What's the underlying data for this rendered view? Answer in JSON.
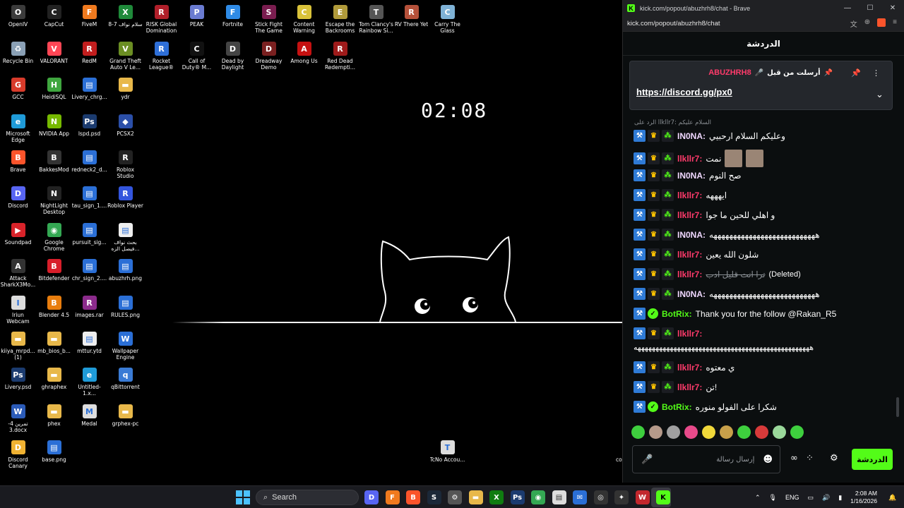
{
  "desktop": {
    "clock": "02:08",
    "icons": [
      {
        "label": "OpenIV",
        "color": "#3b3b3b",
        "glyph": "O"
      },
      {
        "label": "CapCut",
        "color": "#222222",
        "glyph": "C"
      },
      {
        "label": "FiveM",
        "color": "#f07a1e",
        "glyph": "F"
      },
      {
        "label": "سلام نواف 7-8",
        "color": "#1f8a3a",
        "glyph": "X"
      },
      {
        "label": "RISK Global Domination",
        "color": "#b01f2a",
        "glyph": "R"
      },
      {
        "label": "PEAK",
        "color": "#6a7bd1",
        "glyph": "P"
      },
      {
        "label": "Fortnite",
        "color": "#2f8be6",
        "glyph": "F"
      },
      {
        "label": "Stick Fight The Game",
        "color": "#7a1d4f",
        "glyph": "S"
      },
      {
        "label": "Content Warning",
        "color": "#d9c23a",
        "glyph": "C"
      },
      {
        "label": "Escape the Backrooms",
        "color": "#b09a3a",
        "glyph": "E"
      },
      {
        "label": "Tom Clancy's Rainbow Si...",
        "color": "#555555",
        "glyph": "T"
      },
      {
        "label": "RV There Yet",
        "color": "#b5513a",
        "glyph": "R"
      },
      {
        "label": "Carry The Glass",
        "color": "#7fb2d6",
        "glyph": "C"
      },
      {
        "label": "Recycle Bin",
        "color": "#8aa0b5",
        "glyph": "♻"
      },
      {
        "label": "VALORANT",
        "color": "#ff4655",
        "glyph": "V"
      },
      {
        "label": "RedM",
        "color": "#c21e1e",
        "glyph": "R"
      },
      {
        "label": "Grand Theft Auto V Le...",
        "color": "#6b8e23",
        "glyph": "V"
      },
      {
        "label": "Rocket League®",
        "color": "#2e6fd8",
        "glyph": "R"
      },
      {
        "label": "Call of Duty® M...",
        "color": "#111111",
        "glyph": "C"
      },
      {
        "label": "Dead by Daylight",
        "color": "#444444",
        "glyph": "D"
      },
      {
        "label": "Dreadway Demo",
        "color": "#7a2020",
        "glyph": "D"
      },
      {
        "label": "Among Us",
        "color": "#c51111",
        "glyph": "A"
      },
      {
        "label": "Red Dead Redempti...",
        "color": "#9e1b1b",
        "glyph": "R"
      },
      {
        "label": "GCC",
        "color": "#d83b2b",
        "glyph": "G"
      },
      {
        "label": "HeidiSQL",
        "color": "#3fa63f",
        "glyph": "H"
      },
      {
        "label": "Livery_chrg...",
        "color": "#2b6fd6",
        "glyph": "▤"
      },
      {
        "label": "ydr",
        "color": "#e8b84a",
        "glyph": "▬"
      },
      {
        "label": "Microsoft Edge",
        "color": "#1f9bd8",
        "glyph": "e"
      },
      {
        "label": "NVIDIA App",
        "color": "#76b900",
        "glyph": "N"
      },
      {
        "label": "lspd.psd",
        "color": "#1b3b6f",
        "glyph": "Ps"
      },
      {
        "label": "PCSX2",
        "color": "#2b4fa8",
        "glyph": "◆"
      },
      {
        "label": "Brave",
        "color": "#fb542b",
        "glyph": "B"
      },
      {
        "label": "BakkesMod",
        "color": "#333333",
        "glyph": "B"
      },
      {
        "label": "redneck2_d...",
        "color": "#2b6fd6",
        "glyph": "▤"
      },
      {
        "label": "Roblox Studio",
        "color": "#222222",
        "glyph": "R"
      },
      {
        "label": "Discord",
        "color": "#5865f2",
        "glyph": "D"
      },
      {
        "label": "NightLight Desktop",
        "color": "#222222",
        "glyph": "N"
      },
      {
        "label": "tau_sign_1....",
        "color": "#2b6fd6",
        "glyph": "▤"
      },
      {
        "label": "Roblox Player",
        "color": "#3355dd",
        "glyph": "R"
      },
      {
        "label": "Soundpad",
        "color": "#d8232a",
        "glyph": "▶"
      },
      {
        "label": "Google Chrome",
        "color": "#34a853",
        "glyph": "◉"
      },
      {
        "label": "pursuit_sig...",
        "color": "#2b6fd6",
        "glyph": "▤"
      },
      {
        "label": "بحث نواف فيصل الزه...",
        "color": "#eeeeee",
        "glyph": "▤"
      },
      {
        "label": "Attack SharkX3Mo...",
        "color": "#333333",
        "glyph": "A"
      },
      {
        "label": "Bitdefender",
        "color": "#d81e2a",
        "glyph": "B"
      },
      {
        "label": "chr_sign_2....",
        "color": "#2b6fd6",
        "glyph": "▤"
      },
      {
        "label": "abuzhrh.png",
        "color": "#2b6fd6",
        "glyph": "▤"
      },
      {
        "label": "Iriun Webcam",
        "color": "#dddddd",
        "glyph": "I"
      },
      {
        "label": "Blender 4.5",
        "color": "#e87d0d",
        "glyph": "B"
      },
      {
        "label": "images.rar",
        "color": "#8b2b8b",
        "glyph": "R"
      },
      {
        "label": "RULES.png",
        "color": "#2b6fd6",
        "glyph": "▤"
      },
      {
        "label": "kiiya_mrpd... (1)",
        "color": "#e8b84a",
        "glyph": "▬"
      },
      {
        "label": "mb_bios_b...",
        "color": "#e8b84a",
        "glyph": "▬"
      },
      {
        "label": "mttur.ytd",
        "color": "#eeeeee",
        "glyph": "▤"
      },
      {
        "label": "Wallpaper Engine",
        "color": "#2b6fd6",
        "glyph": "W"
      },
      {
        "label": "Livery.psd",
        "color": "#1b3b6f",
        "glyph": "Ps"
      },
      {
        "label": "ghraphex",
        "color": "#e8b84a",
        "glyph": "▬"
      },
      {
        "label": "Untitled-1.x...",
        "color": "#1f9bd8",
        "glyph": "e"
      },
      {
        "label": "qBittorrent",
        "color": "#3a7bd5",
        "glyph": "q"
      },
      {
        "label": "تمرين 4-3.docx",
        "color": "#2b5bb8",
        "glyph": "W"
      },
      {
        "label": "phex",
        "color": "#e8b84a",
        "glyph": "▬"
      },
      {
        "label": "Medal",
        "color": "#dddddd",
        "glyph": "M"
      },
      {
        "label": "grphex-pc",
        "color": "#e8b84a",
        "glyph": "▬"
      },
      {
        "label": "Discord Canary",
        "color": "#f0b232",
        "glyph": "D"
      },
      {
        "label": "base.png",
        "color": "#2b6fd6",
        "glyph": "▤"
      },
      {
        "label": "TcNo Accou...",
        "color": "#dddddd",
        "glyph": "T"
      },
      {
        "label": "conte",
        "color": "#000000",
        "glyph": ""
      }
    ]
  },
  "taskbar": {
    "search_placeholder": "Search",
    "apps": [
      {
        "name": "discord",
        "color": "#5865f2",
        "glyph": "D"
      },
      {
        "name": "fivem",
        "color": "#f07a1e",
        "glyph": "F"
      },
      {
        "name": "brave",
        "color": "#fb542b",
        "glyph": "B"
      },
      {
        "name": "steam",
        "color": "#1b2838",
        "glyph": "S"
      },
      {
        "name": "settings",
        "color": "#555555",
        "glyph": "⚙"
      },
      {
        "name": "file-explorer",
        "color": "#e8b84a",
        "glyph": "▬"
      },
      {
        "name": "xbox",
        "color": "#107c10",
        "glyph": "X"
      },
      {
        "name": "photoshop",
        "color": "#1b3b6f",
        "glyph": "Ps"
      },
      {
        "name": "chrome",
        "color": "#34a853",
        "glyph": "◉"
      },
      {
        "name": "notepad",
        "color": "#dddddd",
        "glyph": "▤"
      },
      {
        "name": "mail",
        "color": "#2b6fd6",
        "glyph": "✉"
      },
      {
        "name": "obs",
        "color": "#333333",
        "glyph": "◎"
      },
      {
        "name": "tool",
        "color": "#333333",
        "glyph": "✦"
      },
      {
        "name": "writer",
        "color": "#c2272d",
        "glyph": "W"
      },
      {
        "name": "kick",
        "color": "#53fc18",
        "glyph": "K"
      }
    ],
    "tray": {
      "language": "ENG",
      "time": "2:08 AM",
      "date": "1/16/2026"
    }
  },
  "browser": {
    "title": "kick.com/popout/abuzhrh8/chat - Brave",
    "url": "kick.com/popout/abuzhrh8/chat",
    "chat_title": "الدردشة",
    "pinned": {
      "sent_by_label": "أرسلت من قبل",
      "user": "ABUZHRH8",
      "link": "https://discord.gg/px0"
    },
    "reply_to": "الرد على llkllr7: السلام عليكم",
    "messages": [
      {
        "user": "IN0NA",
        "user_color": "#f0d8ff",
        "text": "وعليكم السلام ارحبيي",
        "type": "sub"
      },
      {
        "user": "llkllr7",
        "user_color": "#ff3b6b",
        "text": "نمت",
        "type": "sub",
        "thumbs": 2
      },
      {
        "user": "IN0NA",
        "user_color": "#f0d8ff",
        "text": "صح النوم",
        "type": "sub"
      },
      {
        "user": "llkllr7",
        "user_color": "#ff3b6b",
        "text": "ايهههه",
        "type": "sub"
      },
      {
        "user": "llkllr7",
        "user_color": "#ff3b6b",
        "text": "و اهلي للحين ما جوا",
        "type": "sub"
      },
      {
        "user": "IN0NA",
        "user_color": "#f0d8ff",
        "text": "هههههههههههههههههههههههههههه",
        "type": "sub"
      },
      {
        "user": "llkllr7",
        "user_color": "#ff3b6b",
        "text": "شلون الله يعين",
        "type": "sub"
      },
      {
        "user": "llkllr7",
        "user_color": "#ff3b6b",
        "text": "ترا انت قليل ادب",
        "type": "sub",
        "deleted": "(Deleted)"
      },
      {
        "user": "IN0NA",
        "user_color": "#f0d8ff",
        "text": "هههههههههههههههههههههههههههه",
        "type": "sub"
      },
      {
        "user": "BotRix",
        "user_color": "#53fc18",
        "text": "Thank you for the follow @Rakan_R5",
        "type": "bot"
      },
      {
        "user": "llkllr7",
        "user_color": "#ff3b6b",
        "text": "",
        "type": "sub",
        "wrap": "هههههههههههههههههههههههههههههههههههههههههههههههههه"
      },
      {
        "user": "llkllr7",
        "user_color": "#ff3b6b",
        "text": "ي معتوه",
        "type": "sub"
      },
      {
        "user": "llkllr7",
        "user_color": "#ff3b6b",
        "text": "تن!",
        "type": "sub"
      },
      {
        "user": "BotRix",
        "user_color": "#53fc18",
        "text": "شكرا على الفولو منوره",
        "type": "bot"
      }
    ],
    "emotes": [
      "#3ecf3e",
      "#b59a8a",
      "#a0a0a0",
      "#e84a8a",
      "#f0d83a",
      "#c8a04a",
      "#3ecf3e",
      "#d83a3a",
      "#9ad89a",
      "#3ecf3e"
    ],
    "input_placeholder": "إرسال رسالة",
    "send_label": "الدردشة"
  }
}
